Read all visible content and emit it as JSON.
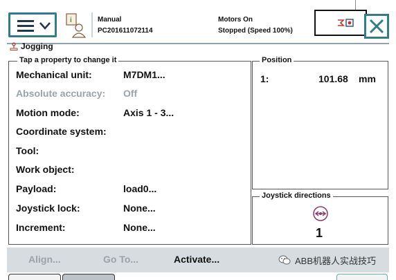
{
  "header": {
    "mode": "Manual",
    "controller": "PC201611072114",
    "motors": "Motors On",
    "state": "Stopped (Speed 100%)"
  },
  "window": {
    "title": "Jogging"
  },
  "properties": {
    "legend": "Tap a property to change it",
    "rows": [
      {
        "label": "Mechanical unit:",
        "value": "M7DM1..."
      },
      {
        "label": "Absolute accuracy:",
        "value": "Off"
      },
      {
        "label": "Motion mode:",
        "value": "Axis 1 - 3..."
      },
      {
        "label": "Coordinate system:",
        "value": ""
      },
      {
        "label": "Tool:",
        "value": ""
      },
      {
        "label": "Work object:",
        "value": ""
      },
      {
        "label": "Payload:",
        "value": "load0..."
      },
      {
        "label": "Joystick lock:",
        "value": "None..."
      },
      {
        "label": "Increment:",
        "value": "None..."
      }
    ]
  },
  "position": {
    "legend": "Position",
    "axis": "1:",
    "value": "101.68",
    "unit": "mm"
  },
  "joystick": {
    "legend": "Joystick directions",
    "axis_number": "1"
  },
  "bottom": {
    "align": "Align...",
    "goto": "Go To...",
    "activate": "Activate...",
    "watermark": "ABB机器人实战技巧"
  },
  "colors": {
    "accent": "#2f7d86",
    "bar": "#d6dcdf",
    "disabled": "#9aa3aa"
  }
}
